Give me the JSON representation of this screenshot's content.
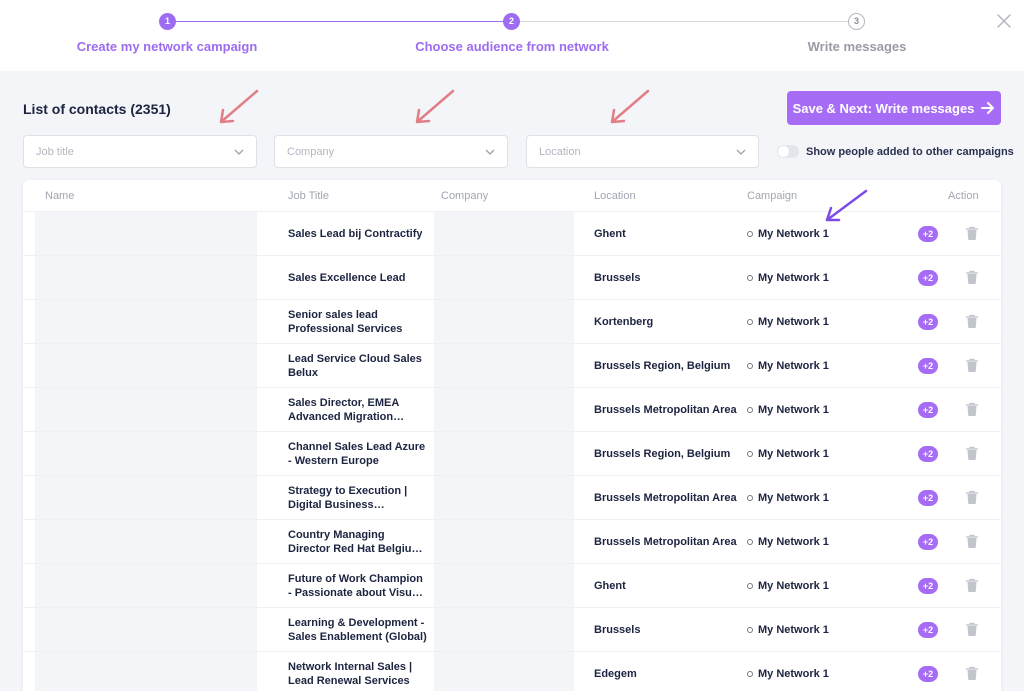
{
  "stepper": {
    "steps": [
      {
        "number": "1",
        "label": "Create my network campaign",
        "state": "done"
      },
      {
        "number": "2",
        "label": "Choose audience from network",
        "state": "active"
      },
      {
        "number": "3",
        "label": "Write messages",
        "state": "upcoming"
      }
    ]
  },
  "header": {
    "list_title": "List of contacts (2351)",
    "save_next_label": "Save & Next: Write messages"
  },
  "filters": {
    "job_title_placeholder": "Job title",
    "company_placeholder": "Company",
    "location_placeholder": "Location",
    "show_other_campaigns_label": "Show people added to other campaigns",
    "show_other_campaigns_on": false
  },
  "table": {
    "columns": {
      "name": "Name",
      "job_title": "Job Title",
      "company": "Company",
      "location": "Location",
      "campaign": "Campaign",
      "action": "Action"
    },
    "rows": [
      {
        "job_title": "Sales Lead bij Contractify",
        "location": "Ghent",
        "campaign": "My Network 1",
        "extra": "+2"
      },
      {
        "job_title": "Sales Excellence Lead",
        "location": "Brussels",
        "campaign": "My Network 1",
        "extra": "+2"
      },
      {
        "job_title": "Senior sales lead Professional Services",
        "location": "Kortenberg",
        "campaign": "My Network 1",
        "extra": "+2"
      },
      {
        "job_title": "Lead Service Cloud Sales Belux",
        "location": "Brussels Region, Belgium",
        "campaign": "My Network 1",
        "extra": "+2"
      },
      {
        "job_title": "Sales Director, EMEA Advanced Migration Leader",
        "location": "Brussels Metropolitan Area",
        "campaign": "My Network 1",
        "extra": "+2"
      },
      {
        "job_title": "Channel Sales Lead Azure - Western Europe",
        "location": "Brussels Region, Belgium",
        "campaign": "My Network 1",
        "extra": "+2"
      },
      {
        "job_title": "Strategy to Execution | Digital Business Transformation",
        "location": "Brussels Metropolitan Area",
        "campaign": "My Network 1",
        "extra": "+2"
      },
      {
        "job_title": "Country Managing Director Red Hat Belgium & Luxembourg",
        "location": "Brussels Metropolitan Area",
        "campaign": "My Network 1",
        "extra": "+2"
      },
      {
        "job_title": "Future of Work Champion - Passionate about Visual Storytelling",
        "location": "Ghent",
        "campaign": "My Network 1",
        "extra": "+2"
      },
      {
        "job_title": "Learning & Development - Sales Enablement (Global)",
        "location": "Brussels",
        "campaign": "My Network 1",
        "extra": "+2"
      },
      {
        "job_title": "Network Internal Sales | Lead Renewal Services",
        "location": "Edegem",
        "campaign": "My Network 1",
        "extra": "+2"
      }
    ]
  },
  "colors": {
    "accent": "#a66cf6",
    "step_active": "#9d6cf0",
    "annotation_pink": "#e07f86",
    "annotation_purple": "#7c4ce8"
  },
  "icons": {
    "close": "close-icon",
    "arrow": "arrow-right-icon",
    "dropdown": "chevron-down-icon",
    "delete": "trash-icon"
  }
}
